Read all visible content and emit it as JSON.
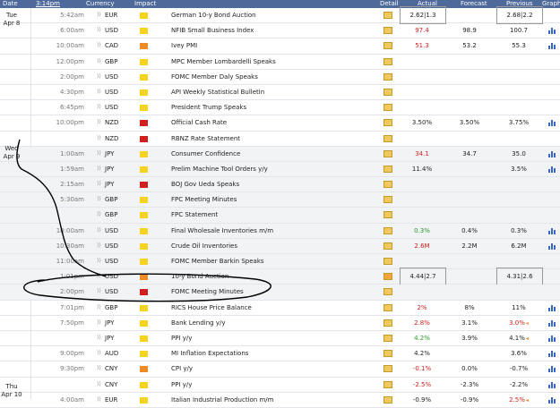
{
  "header": {
    "date": "Date",
    "time": "3:14pm",
    "currency": "Currency",
    "impact": "Impact",
    "detail": "Detail",
    "actual": "Actual",
    "forecast": "Forecast",
    "previous": "Previous",
    "graph": "Graph"
  },
  "days": [
    {
      "day": "Tue",
      "date": "Apr 8"
    },
    {
      "day": "Wed",
      "date": "Apr 9"
    },
    {
      "day": "Thu",
      "date": "Apr 10"
    }
  ],
  "impact_colors": {
    "low": "#f5d320",
    "medium": "#f08a24",
    "high": "#d11e1e"
  },
  "rows": [
    {
      "time": "5:42am",
      "currency": "EUR",
      "impact": "low",
      "event": "German 10-y Bond Auction",
      "actual": "2.62|1.3",
      "forecast": "",
      "previous": "2.68|2.2",
      "actual_boxed": true,
      "previous_boxed": true,
      "graph": false
    },
    {
      "time": "6:00am",
      "currency": "USD",
      "impact": "low",
      "event": "NFIB Small Business Index",
      "actual": "97.4",
      "actual_class": "bad",
      "forecast": "98.9",
      "previous": "100.7",
      "graph": true
    },
    {
      "time": "10:00am",
      "currency": "CAD",
      "impact": "medium",
      "event": "Ivey PMI",
      "actual": "51.3",
      "actual_class": "bad",
      "forecast": "53.2",
      "previous": "55.3",
      "graph": true
    },
    {
      "time": "12:00pm",
      "currency": "GBP",
      "impact": "low",
      "event": "MPC Member Lombardelli Speaks",
      "actual": "",
      "forecast": "",
      "previous": "",
      "graph": false
    },
    {
      "time": "2:00pm",
      "currency": "USD",
      "impact": "low",
      "event": "FOMC Member Daly Speaks",
      "actual": "",
      "forecast": "",
      "previous": "",
      "graph": false
    },
    {
      "time": "4:30pm",
      "currency": "USD",
      "impact": "low",
      "event": "API Weekly Statistical Bulletin",
      "actual": "",
      "forecast": "",
      "previous": "",
      "graph": false
    },
    {
      "time": "6:45pm",
      "currency": "USD",
      "impact": "low",
      "event": "President Trump Speaks",
      "actual": "",
      "forecast": "",
      "previous": "",
      "graph": false
    },
    {
      "time": "10:00pm",
      "currency": "NZD",
      "impact": "high",
      "event": "Official Cash Rate",
      "actual": "3.50%",
      "forecast": "3.50%",
      "previous": "3.75%",
      "graph": true
    },
    {
      "time": "",
      "currency": "NZD",
      "impact": "high",
      "event": "RBNZ Rate Statement",
      "actual": "",
      "forecast": "",
      "previous": "",
      "graph": false
    },
    {
      "time": "1:00am",
      "currency": "JPY",
      "impact": "low",
      "event": "Consumer Confidence",
      "actual": "34.1",
      "actual_class": "bad",
      "forecast": "34.7",
      "previous": "35.0",
      "graph": true
    },
    {
      "time": "1:59am",
      "currency": "JPY",
      "impact": "low",
      "event": "Prelim Machine Tool Orders y/y",
      "actual": "11.4%",
      "forecast": "",
      "previous": "3.5%",
      "graph": true
    },
    {
      "time": "2:15am",
      "currency": "JPY",
      "impact": "high",
      "event": "BOJ Gov Ueda Speaks",
      "actual": "",
      "forecast": "",
      "previous": "",
      "graph": false
    },
    {
      "time": "5:30am",
      "currency": "GBP",
      "impact": "low",
      "event": "FPC Meeting Minutes",
      "actual": "",
      "forecast": "",
      "previous": "",
      "graph": false
    },
    {
      "time": "",
      "currency": "GBP",
      "impact": "low",
      "event": "FPC Statement",
      "actual": "",
      "forecast": "",
      "previous": "",
      "graph": false
    },
    {
      "time": "10:00am",
      "currency": "USD",
      "impact": "low",
      "event": "Final Wholesale Inventories m/m",
      "actual": "0.3%",
      "actual_class": "good",
      "forecast": "0.4%",
      "previous": "0.3%",
      "graph": true
    },
    {
      "time": "10:30am",
      "currency": "USD",
      "impact": "low",
      "event": "Crude Oil Inventories",
      "actual": "2.6M",
      "actual_class": "bad",
      "forecast": "2.2M",
      "previous": "6.2M",
      "graph": true
    },
    {
      "time": "11:00am",
      "currency": "USD",
      "impact": "low",
      "event": "FOMC Member Barkin Speaks",
      "actual": "",
      "forecast": "",
      "previous": "",
      "graph": false
    },
    {
      "time": "1:01pm",
      "currency": "USD",
      "impact": "medium",
      "event": "10-y Bond Auction",
      "actual": "4.44|2.7",
      "forecast": "",
      "previous": "4.31|2.6",
      "actual_boxed": true,
      "previous_boxed": true,
      "detail_alert": true,
      "graph": false
    },
    {
      "time": "2:00pm",
      "currency": "USD",
      "impact": "high",
      "event": "FOMC Meeting Minutes",
      "actual": "",
      "forecast": "",
      "previous": "",
      "graph": false
    },
    {
      "time": "7:01pm",
      "currency": "GBP",
      "impact": "low",
      "event": "RICS House Price Balance",
      "actual": "2%",
      "actual_class": "bad",
      "forecast": "8%",
      "previous": "11%",
      "graph": true
    },
    {
      "time": "7:50pm",
      "currency": "JPY",
      "impact": "low",
      "event": "Bank Lending y/y",
      "actual": "2.8%",
      "actual_class": "bad",
      "forecast": "3.1%",
      "previous": "3.0%",
      "previous_class": "bad",
      "previous_revised": true,
      "graph": true
    },
    {
      "time": "",
      "currency": "JPY",
      "impact": "low",
      "event": "PPI y/y",
      "actual": "4.2%",
      "actual_class": "good",
      "forecast": "3.9%",
      "previous": "4.1%",
      "previous_revised": true,
      "graph": true
    },
    {
      "time": "9:00pm",
      "currency": "AUD",
      "impact": "low",
      "event": "MI Inflation Expectations",
      "actual": "4.2%",
      "forecast": "",
      "previous": "3.6%",
      "graph": true
    },
    {
      "time": "9:30pm",
      "currency": "CNY",
      "impact": "medium",
      "event": "CPI y/y",
      "actual": "-0.1%",
      "actual_class": "bad",
      "forecast": "0.0%",
      "previous": "-0.7%",
      "graph": true
    },
    {
      "time": "",
      "currency": "CNY",
      "impact": "low",
      "event": "PPI y/y",
      "actual": "-2.5%",
      "actual_class": "bad",
      "forecast": "-2.3%",
      "previous": "-2.2%",
      "graph": true
    },
    {
      "time": "4:00am",
      "currency": "EUR",
      "impact": "low",
      "event": "Italian Industrial Production m/m",
      "actual": "-0.9%",
      "forecast": "-0.9%",
      "previous": "2.5%",
      "previous_class": "bad",
      "previous_revised": true,
      "graph": true
    }
  ]
}
